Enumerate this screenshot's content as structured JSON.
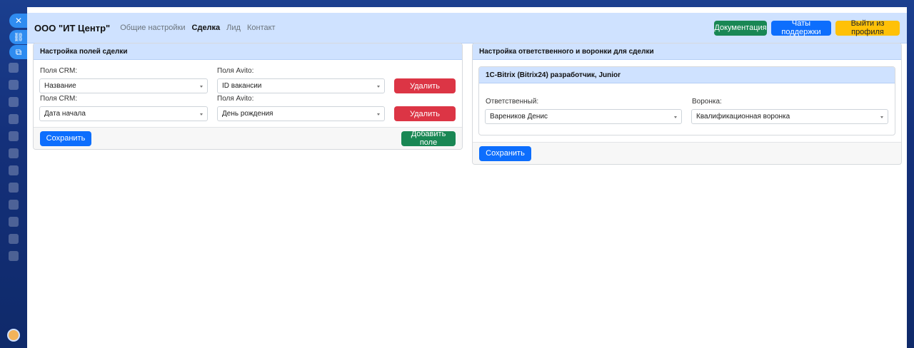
{
  "navbar": {
    "brand": "ООО \"ИТ Центр\"",
    "links": [
      {
        "label": "Общие настройки",
        "active": false
      },
      {
        "label": "Сделка",
        "active": true
      },
      {
        "label": "Лид",
        "active": false
      },
      {
        "label": "Контакт",
        "active": false
      }
    ],
    "buttons": {
      "docs": "Документация",
      "support": "Чаты поддержки",
      "logout": "Выйти из профиля"
    }
  },
  "fields_card": {
    "title": "Настройка полей сделки",
    "rows": [
      {
        "crm_label": "Поля CRM:",
        "crm_value": "Название",
        "avito_label": "Поля Avito:",
        "avito_value": "ID вакансии",
        "delete_label": "Удалить"
      },
      {
        "crm_label": "Поля CRM:",
        "crm_value": "Дата начала",
        "avito_label": "Поля Avito:",
        "avito_value": "День рождения",
        "delete_label": "Удалить"
      }
    ],
    "save_label": "Сохранить",
    "add_label": "Добавить поле"
  },
  "responsible_card": {
    "title": "Настройка ответственного и воронки для сделки",
    "vacancy": {
      "title": "1С-Bitrix (Bitrix24) разработчик, Junior",
      "responsible_label": "Ответственный:",
      "responsible_value": "Вареников Денис",
      "funnel_label": "Воронка:",
      "funnel_value": "Квалификационная воронка"
    },
    "save_label": "Сохранить"
  },
  "colors": {
    "header_bg": "#cfe2ff",
    "primary": "#0d6efd",
    "success": "#198754",
    "danger": "#dc3545",
    "warning": "#ffc107"
  }
}
